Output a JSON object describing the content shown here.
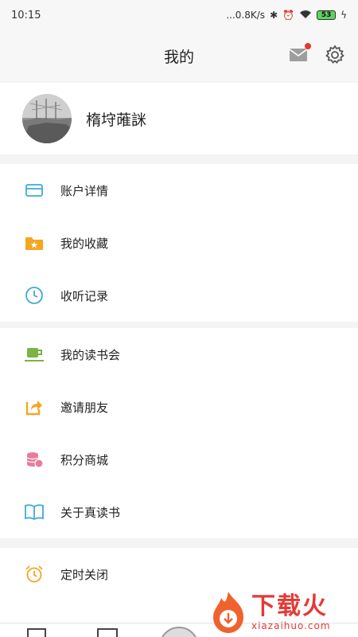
{
  "status_bar": {
    "time": "10:15",
    "network_speed": "...0.8K/s",
    "battery": "53"
  },
  "header": {
    "title": "我的",
    "icons": [
      "mail-icon",
      "gear-icon"
    ]
  },
  "profile": {
    "username": "楕垨蓶詸"
  },
  "menu": {
    "group1": [
      {
        "label": "账户详情",
        "icon": "card-icon",
        "color": "#3fa9d8"
      },
      {
        "label": "我的收藏",
        "icon": "folder-star-icon",
        "color": "#f5a623"
      },
      {
        "label": "收听记录",
        "icon": "clock-icon",
        "color": "#3fa9d8"
      }
    ],
    "group2": [
      {
        "label": "我的读书会",
        "icon": "cup-icon",
        "color": "#7cb342"
      },
      {
        "label": "邀请朋友",
        "icon": "share-icon",
        "color": "#f5a623"
      },
      {
        "label": "积分商城",
        "icon": "coins-icon",
        "color": "#ec7a9a"
      },
      {
        "label": "关于真读书",
        "icon": "book-icon",
        "color": "#3fa9d8"
      }
    ],
    "group3": [
      {
        "label": "定时关闭",
        "icon": "alarm-icon",
        "color": "#f5a623"
      }
    ]
  },
  "watermark": {
    "cn": "下载火",
    "url": "xiazaihuo.com"
  }
}
